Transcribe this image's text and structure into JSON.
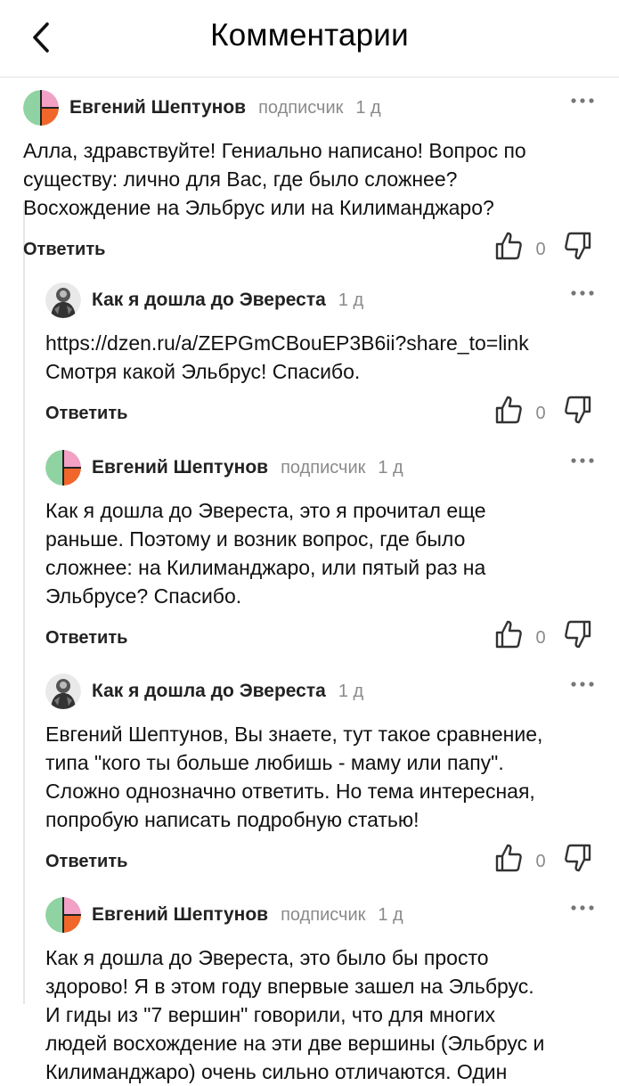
{
  "header": {
    "title": "Комментарии"
  },
  "comments": [
    {
      "author": "Евгений Шептунов",
      "badge": "подписчик",
      "time": "1 д",
      "text": "Алла, здравствуйте! Гениально написано! Вопрос по\nсуществу: лично для Вас, где было сложнее?\nВосхождение на Эльбрус или на Килиманджаро?",
      "reply_label": "Ответить",
      "likes": "0",
      "avatar": "tri-color"
    },
    {
      "author": "Как я дошла до Эвереста",
      "badge": "",
      "time": "1 д",
      "text": "https://dzen.ru/a/ZEPGmCBouEP3B6ii?share_to=link\nСмотря какой Эльбрус! Спасибо.",
      "reply_label": "Ответить",
      "likes": "0",
      "avatar": "climber"
    },
    {
      "author": "Евгений Шептунов",
      "badge": "подписчик",
      "time": "1 д",
      "text": "Как я дошла до Эвереста, это я прочитал еще\nраньше. Поэтому и возник вопрос, где было\nсложнее: на Килиманджаро, или пятый раз на\nЭльбрусе? Спасибо.",
      "reply_label": "Ответить",
      "likes": "0",
      "avatar": "tri-color"
    },
    {
      "author": "Как я дошла до Эвереста",
      "badge": "",
      "time": "1 д",
      "text": "Евгений Шептунов, Вы знаете, тут такое сравнение,\nтипа \"кого ты больше любишь - маму или папу\".\nСложно однозначно ответить. Но тема интересная,\nпопробую написать подробную статью!",
      "reply_label": "Ответить",
      "likes": "0",
      "avatar": "climber"
    },
    {
      "author": "Евгений Шептунов",
      "badge": "подписчик",
      "time": "1 д",
      "text": "Как я дошла до Эвереста, это было бы просто\nздорово! Я в этом году впервые зашел на Эльбрус.\nИ гиды из \"7 вершин\" говорили, что для многих\nлюдей восхождение на эти две вершины (Эльбрус и\nКилиманджаро) очень сильно отличаются. Один",
      "reply_label": "Ответить",
      "likes": "0",
      "avatar": "tri-color"
    }
  ],
  "colors": {
    "avatar_green": "#8fd3a2",
    "avatar_orange": "#f0662b",
    "avatar_pink": "#f2a0c6",
    "muted": "#8a8a8a"
  },
  "icons": [
    "back-arrow-icon",
    "more-dots-icon",
    "thumb-up-icon",
    "thumb-down-icon"
  ]
}
